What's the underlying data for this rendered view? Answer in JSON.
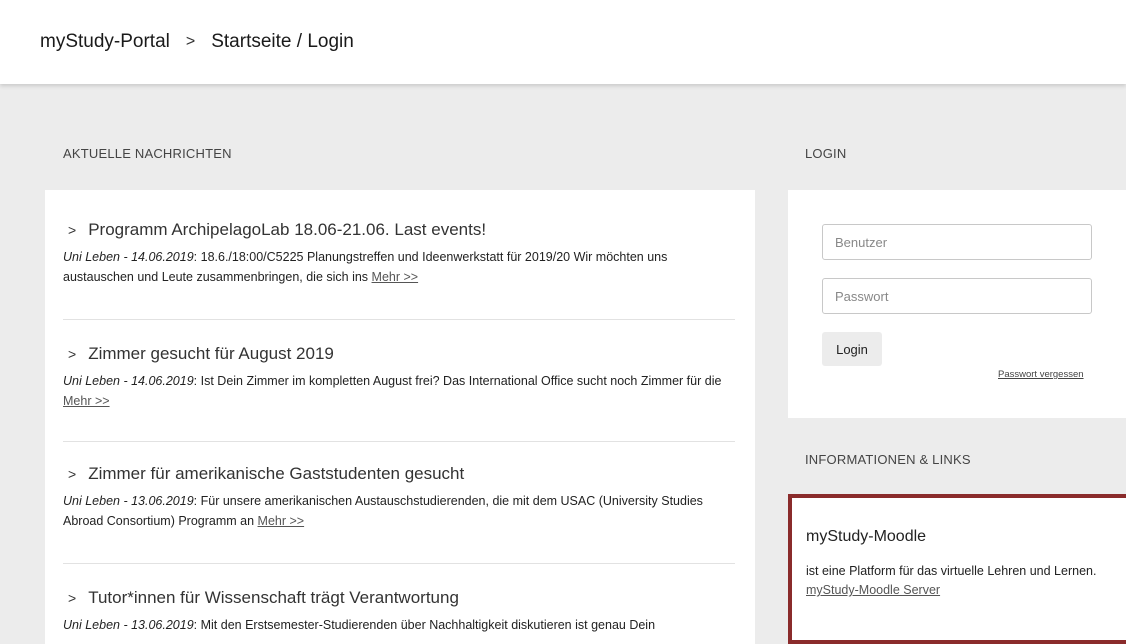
{
  "header": {
    "portal": "myStudy-Portal",
    "separator": ">",
    "page": "Startseite / Login"
  },
  "news": {
    "section_title": "AKTUELLE NACHRICHTEN",
    "more_label": "Mehr >>",
    "items": [
      {
        "title": "Programm ArchipelagoLab 18.06-21.06. Last events!",
        "meta": "Uni Leben - 14.06.2019",
        "text": ": 18.6./18:00/C5225 Planungstreffen und Ideenwerkstatt für 2019/20 Wir möchten uns austauschen und Leute zusammenbringen, die sich ins "
      },
      {
        "title": "Zimmer gesucht für August 2019",
        "meta": "Uni Leben - 14.06.2019",
        "text": ": Ist Dein Zimmer im kompletten August frei? Das International Office sucht noch Zimmer für die "
      },
      {
        "title": "Zimmer für amerikanische Gaststudenten gesucht",
        "meta": "Uni Leben - 13.06.2019",
        "text": ": Für unsere amerikanischen Austauschstudierenden, die mit dem USAC (University Studies Abroad Consortium) Programm an "
      },
      {
        "title": "Tutor*innen für Wissenschaft trägt Verantwortung",
        "meta": "Uni Leben - 13.06.2019",
        "text": ": Mit den Erstsemester-Studierenden über Nachhaltigkeit diskutieren ist genau Dein"
      }
    ]
  },
  "login": {
    "section_title": "LOGIN",
    "user_placeholder": "Benutzer",
    "password_placeholder": "Passwort",
    "button_label": "Login",
    "forgot_label": "Passwort vergessen"
  },
  "info": {
    "section_title": "INFORMATIONEN & LINKS",
    "title": "myStudy-Moodle",
    "text": "ist eine Platform für das virtuelle Lehren und Lernen.",
    "link": "myStudy-Moodle Server",
    "accent_color": "#8a2b2b"
  }
}
